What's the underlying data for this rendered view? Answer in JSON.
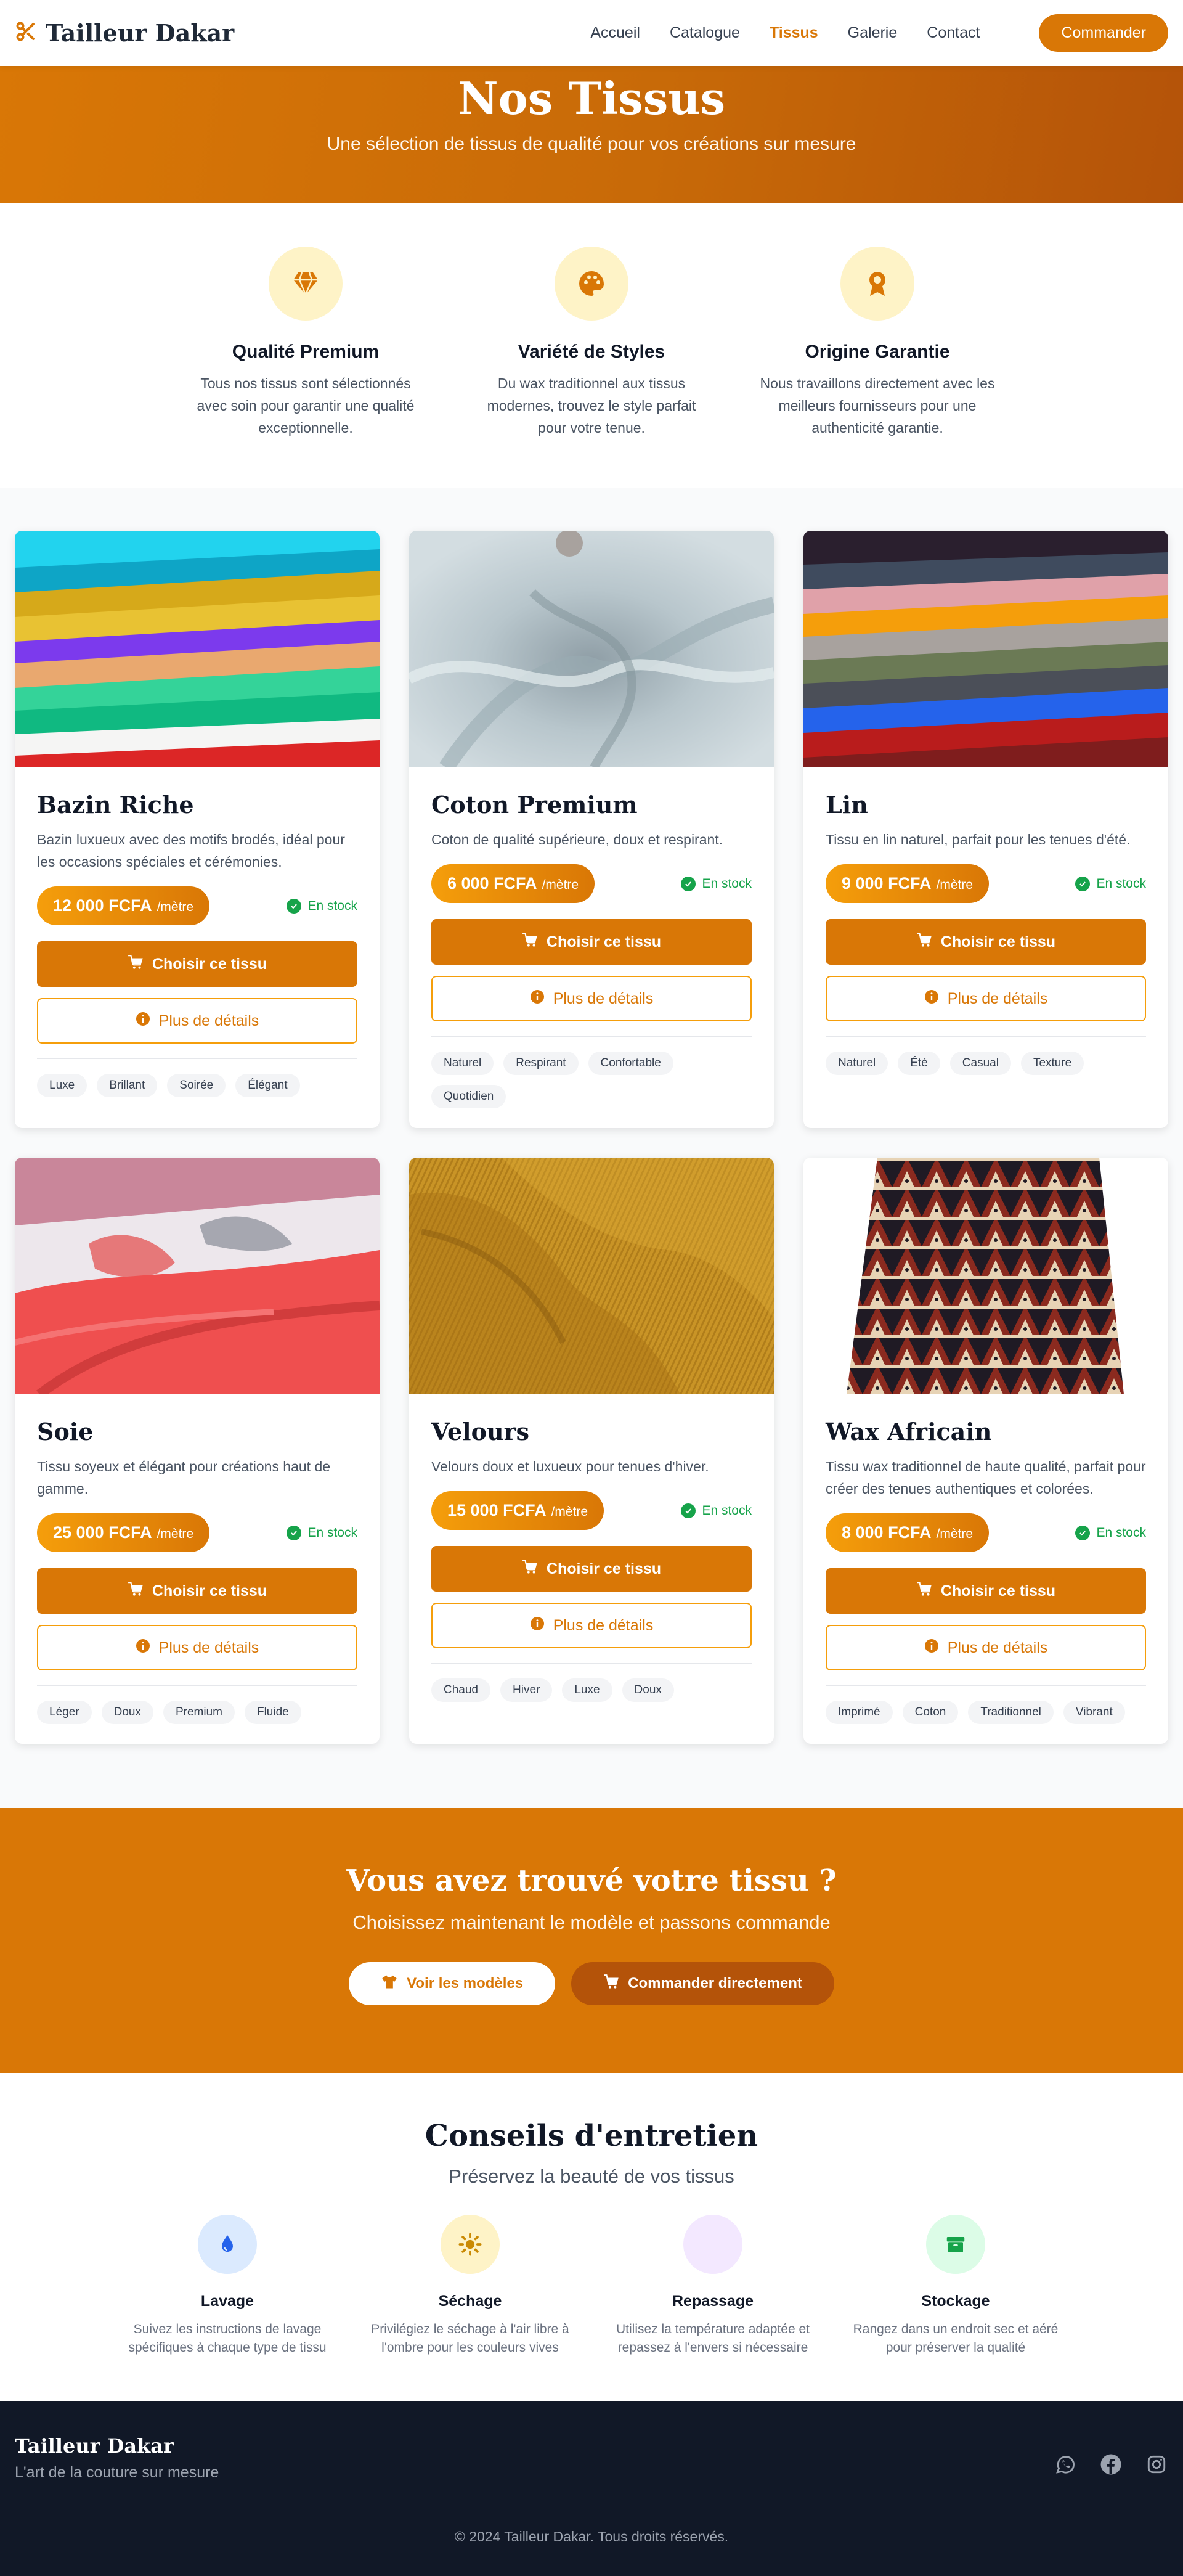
{
  "nav": {
    "brand": "Tailleur Dakar",
    "links": [
      "Accueil",
      "Catalogue",
      "Tissus",
      "Galerie",
      "Contact"
    ],
    "active": "Tissus",
    "cta": "Commander"
  },
  "hero": {
    "title": "Nos Tissus",
    "subtitle": "Une sélection de tissus de qualité pour vos créations sur mesure"
  },
  "features": [
    {
      "icon": "gem-icon",
      "title": "Qualité Premium",
      "text": "Tous nos tissus sont sélectionnés avec soin pour garantir une qualité exceptionnelle."
    },
    {
      "icon": "palette-icon",
      "title": "Variété de Styles",
      "text": "Du wax traditionnel aux tissus modernes, trouvez le style parfait pour votre tenue."
    },
    {
      "icon": "award-icon",
      "title": "Origine Garantie",
      "text": "Nous travaillons directement avec les meilleurs fournisseurs pour une authenticité garantie."
    }
  ],
  "products": [
    {
      "name": "Bazin Riche",
      "desc": "Bazin luxueux avec des motifs brodés, idéal pour les occasions spéciales et cérémonies.",
      "price": "12 000 FCFA",
      "unit": "/mètre",
      "stock": "En stock",
      "choose": "Choisir ce tissu",
      "details": "Plus de détails",
      "tags": [
        "Luxe",
        "Brillant",
        "Soirée",
        "Élégant"
      ]
    },
    {
      "name": "Coton Premium",
      "desc": "Coton de qualité supérieure, doux et respirant.",
      "price": "6 000 FCFA",
      "unit": "/mètre",
      "stock": "En stock",
      "choose": "Choisir ce tissu",
      "details": "Plus de détails",
      "tags": [
        "Naturel",
        "Respirant",
        "Confortable",
        "Quotidien"
      ]
    },
    {
      "name": "Lin",
      "desc": "Tissu en lin naturel, parfait pour les tenues d'été.",
      "price": "9 000 FCFA",
      "unit": "/mètre",
      "stock": "En stock",
      "choose": "Choisir ce tissu",
      "details": "Plus de détails",
      "tags": [
        "Naturel",
        "Été",
        "Casual",
        "Texture"
      ]
    },
    {
      "name": "Soie",
      "desc": "Tissu soyeux et élégant pour créations haut de gamme.",
      "price": "25 000 FCFA",
      "unit": "/mètre",
      "stock": "En stock",
      "choose": "Choisir ce tissu",
      "details": "Plus de détails",
      "tags": [
        "Léger",
        "Doux",
        "Premium",
        "Fluide"
      ]
    },
    {
      "name": "Velours",
      "desc": "Velours doux et luxueux pour tenues d'hiver.",
      "price": "15 000 FCFA",
      "unit": "/mètre",
      "stock": "En stock",
      "choose": "Choisir ce tissu",
      "details": "Plus de détails",
      "tags": [
        "Chaud",
        "Hiver",
        "Luxe",
        "Doux"
      ]
    },
    {
      "name": "Wax Africain",
      "desc": "Tissu wax traditionnel de haute qualité, parfait pour créer des tenues authentiques et colorées.",
      "price": "8 000 FCFA",
      "unit": "/mètre",
      "stock": "En stock",
      "choose": "Choisir ce tissu",
      "details": "Plus de détails",
      "tags": [
        "Imprimé",
        "Coton",
        "Traditionnel",
        "Vibrant"
      ]
    }
  ],
  "cta": {
    "title": "Vous avez trouvé votre tissu ?",
    "subtitle": "Choisissez maintenant le modèle et passons commande",
    "btn_models": "Voir les modèles",
    "btn_order": "Commander directement"
  },
  "care": {
    "title": "Conseils d'entretien",
    "subtitle": "Préservez la beauté de vos tissus",
    "items": [
      {
        "icon": "droplet-icon",
        "title": "Lavage",
        "text": "Suivez les instructions de lavage spécifiques à chaque type de tissu"
      },
      {
        "icon": "sun-icon",
        "title": "Séchage",
        "text": "Privilégiez le séchage à l'air libre à l'ombre pour les couleurs vives"
      },
      {
        "icon": "iron-icon",
        "title": "Repassage",
        "text": "Utilisez la température adaptée et repassez à l'envers si nécessaire"
      },
      {
        "icon": "box-icon",
        "title": "Stockage",
        "text": "Rangez dans un endroit sec et aéré pour préserver la qualité"
      }
    ]
  },
  "footer": {
    "brand": "Tailleur Dakar",
    "tagline": "L'art de la couture sur mesure",
    "copyright": "© 2024 Tailleur Dakar. Tous droits réservés."
  },
  "colors": {
    "accent": "#d97706",
    "accent_dark": "#b45309",
    "footer_bg": "#111827",
    "stock_green": "#16a34a"
  }
}
